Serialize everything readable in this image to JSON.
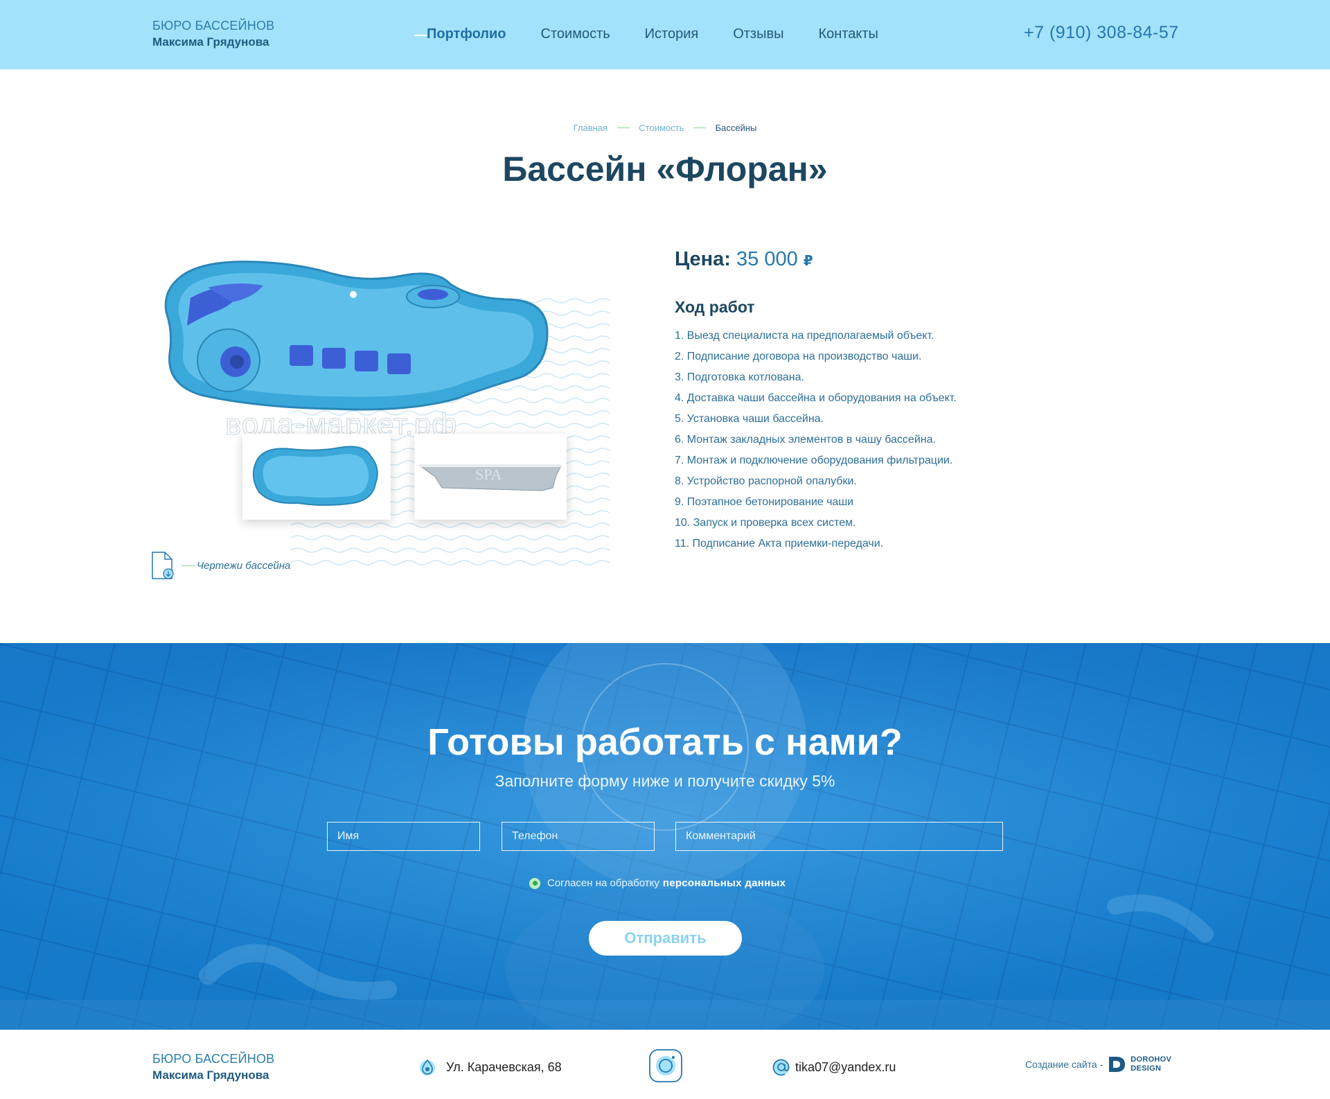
{
  "header": {
    "logo_line1": "БЮРО БАССЕЙНОВ",
    "logo_line2": "Максима Грядунова",
    "nav": [
      {
        "label": "Портфолио",
        "active": true
      },
      {
        "label": "Стоимость",
        "active": false
      },
      {
        "label": "История",
        "active": false
      },
      {
        "label": "Отзывы",
        "active": false
      },
      {
        "label": "Контакты",
        "active": false
      }
    ],
    "phone": "+7 (910) 308-84-57"
  },
  "breadcrumb": {
    "home": "Главная",
    "cost": "Стоимость",
    "current": "Бассейны"
  },
  "page_title": "Бассейн «Флоран»",
  "product": {
    "watermark": "вода-маркет.рф",
    "thumb2_text": "SPA",
    "drawings_label": "Чертежи бассейна",
    "price_label": "Цена:",
    "price_value": "35 000",
    "currency": "₽",
    "steps_title": "Ход работ",
    "steps": [
      "1. Выезд специалиста на предполагаемый объект.",
      "2. Подписание договора на производство чаши.",
      "3. Подготовка котлована.",
      "4. Доставка чаши бассейна и оборудования на объект.",
      "5. Установка чаши бассейна.",
      "6. Монтаж закладных элементов в чашу бассейна.",
      "7. Монтаж и подключение оборудования фильтрации.",
      "8. Устройство распорной опалубки.",
      "9. Поэтапное бетонирование чаши",
      "10. Запуск и проверка всех систем.",
      "11. Подписание Акта приемки-передачи."
    ]
  },
  "cta": {
    "title": "Готовы работать с нами?",
    "subtitle": "Заполните форму ниже и получите скидку 5%",
    "name_placeholder": "Имя",
    "phone_placeholder": "Телефон",
    "comment_placeholder": "Комментарий",
    "consent_text": "Согласен на обработку",
    "consent_bold": "персональных  данных",
    "submit_label": "Отправить"
  },
  "footer": {
    "logo_line1": "БЮРО БАССЕЙНОВ",
    "logo_line2": "Максима Грядунова",
    "address": "Ул. Карачевская, 68",
    "email": "tika07@yandex.ru",
    "credit_label": "Создание сайта -",
    "credit_name1": "DOROHOV",
    "credit_name2": "DESIGN"
  },
  "icons": {
    "location": "location-pin-icon",
    "instagram": "instagram-icon",
    "email": "at-sign-icon",
    "download": "file-download-icon"
  },
  "colors": {
    "header_bg": "#a3e2fb",
    "accent": "#2577ad",
    "title": "#1d4760",
    "cta_bg": "#1a86d6",
    "green_line": "#8fd48f"
  }
}
